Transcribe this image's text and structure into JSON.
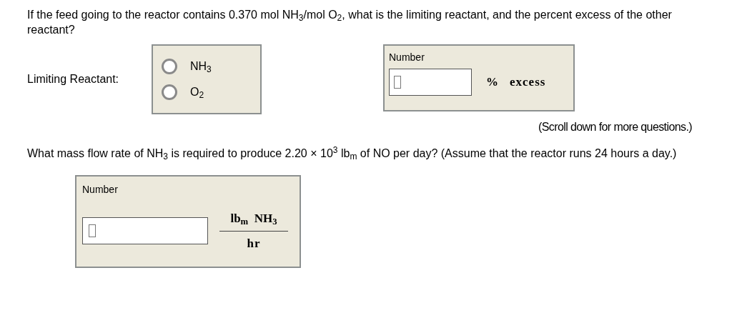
{
  "question_1": {
    "prompt": "If the feed going to the reactor contains 0.370 mol NH$_{3}$/mol O$_{2}$, what is the limiting reactant, and the percent excess of the other reactant?",
    "limiting_label": "Limiting Reactant:",
    "options": [
      {
        "label": "NH$_{3}$",
        "selected": false
      },
      {
        "label": "O$_{2}$",
        "selected": false
      }
    ],
    "answer": {
      "label": "Number",
      "unit": "%",
      "unit_word": "excess"
    },
    "note": "(Scroll down for more questions.)"
  },
  "question_2": {
    "prompt": "What mass flow rate of NH$_{3}$ is required to produce 2.20 × 10$^{3}$ lb$_{m}$ of NO per day? (Assume that the reactor runs 24 hours a day.)",
    "answer": {
      "label": "Number",
      "unit_numerator": "lb$_{m}$  NH$_{3}$",
      "unit_denominator": "hr"
    }
  }
}
